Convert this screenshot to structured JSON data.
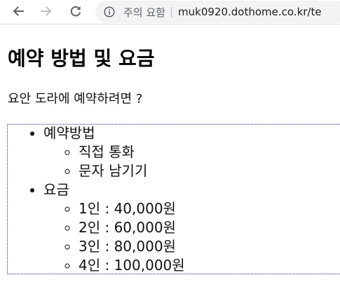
{
  "browser": {
    "security_label": "주의 요함",
    "separator": "|",
    "url": "muk0920.dothome.co.kr/te"
  },
  "page": {
    "title": "예약 방법 및 요금",
    "intro": "요안 도라에 예약하려면 ?",
    "list": [
      {
        "label": "예약방법",
        "children": [
          "직접 통화",
          "문자 남기기"
        ]
      },
      {
        "label": "요금",
        "children": [
          "1인 : 40,000원",
          "2인 : 60,000원",
          "3인 : 80,000원",
          "4인 : 100,000원"
        ]
      }
    ]
  },
  "colors": {
    "toolbar_icon": "#5f6368",
    "toolbar_icon_disabled": "#bdc1c6",
    "omnibox_bg": "#f1f3f4",
    "outline": "#1f2a8a"
  }
}
